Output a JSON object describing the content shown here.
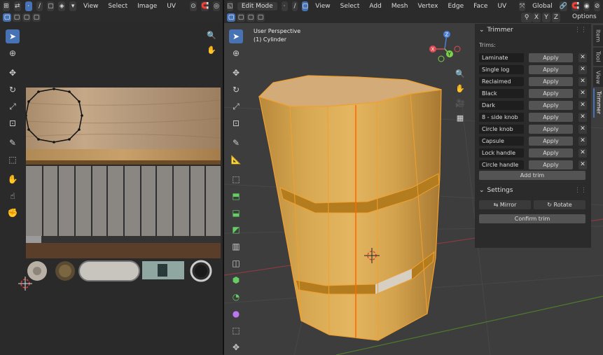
{
  "uv_header": {
    "view": "View",
    "select": "Select",
    "image": "Image",
    "uv": "UV"
  },
  "viewport_header": {
    "mode": "Edit Mode",
    "view": "View",
    "select": "Select",
    "add": "Add",
    "mesh": "Mesh",
    "vertex": "Vertex",
    "edge": "Edge",
    "face": "Face",
    "uv": "UV",
    "orientation": "Global",
    "axis_x": "X",
    "axis_y": "Y",
    "axis_z": "Z",
    "options": "Options"
  },
  "viewport_info": {
    "perspective": "User Perspective",
    "object": "(1) Cylinder"
  },
  "gizmo": {
    "z": "Z",
    "y": "Y",
    "x": "X"
  },
  "trimmer": {
    "title": "Trimmer",
    "trims_label": "Trims:",
    "apply_label": "Apply",
    "remove_label": "✕",
    "trims": [
      "Laminate",
      "Single log",
      "Reclaimed",
      "Black",
      "Dark",
      "8 - side knob",
      "Circle knob",
      "Capsule",
      "Lock handle",
      "Circle handle"
    ],
    "add_trim": "Add trim"
  },
  "settings": {
    "title": "Settings",
    "mirror": "Mirror",
    "rotate": "Rotate",
    "confirm": "Confirm trim"
  },
  "side_tabs": [
    "Item",
    "Tool",
    "View",
    "Trimmer"
  ],
  "colors": {
    "accent": "#4772b3",
    "selection": "#f5a623",
    "wood": "#d9a447"
  }
}
